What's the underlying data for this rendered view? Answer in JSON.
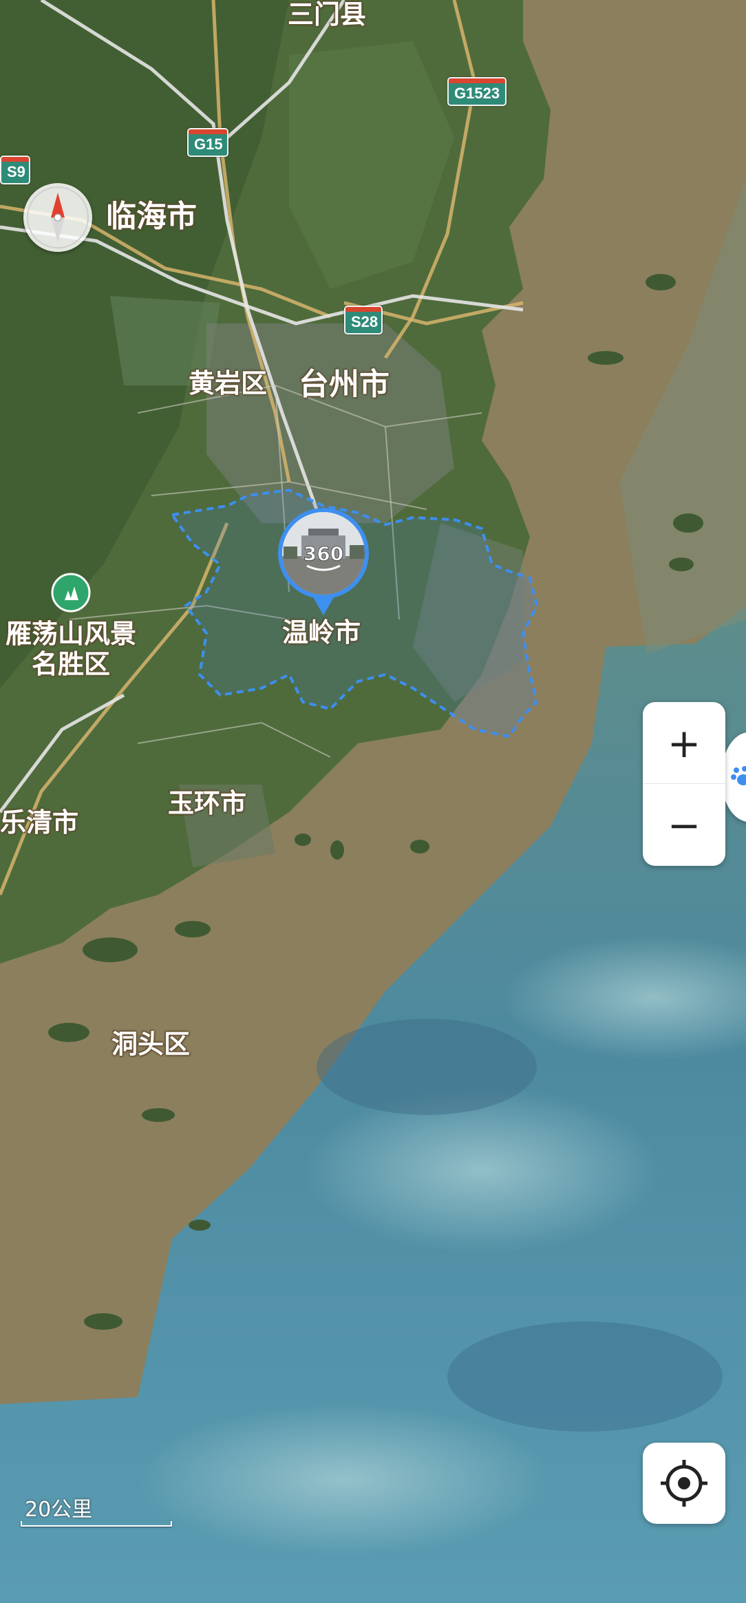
{
  "map": {
    "places": {
      "sanmen": "三门县",
      "linhai": "临海市",
      "huangyan": "黄岩区",
      "taizhou": "台州市",
      "wenling": "温岭市",
      "yandangshan": "雁荡山风景\n名胜区",
      "yuhuan": "玉环市",
      "yueqing": "乐清市",
      "dongtou": "洞头区"
    },
    "roads": {
      "g1523": "G1523",
      "g15": "G15",
      "s9": "S9",
      "s28": "S28"
    },
    "panorama_label": "360",
    "scale_label": "20公里",
    "colors": {
      "land": "#4f6b3c",
      "mud_water": "#8a7d5c",
      "sea": "#4f8fa3",
      "boundary": "#3d8ff0",
      "highway": "#d8b46a",
      "shield_green": "#2e8b78"
    }
  },
  "controls": {
    "zoom_in": "+",
    "zoom_out": "−",
    "compass_icon": "compass-icon",
    "locate_icon": "locate-icon"
  }
}
